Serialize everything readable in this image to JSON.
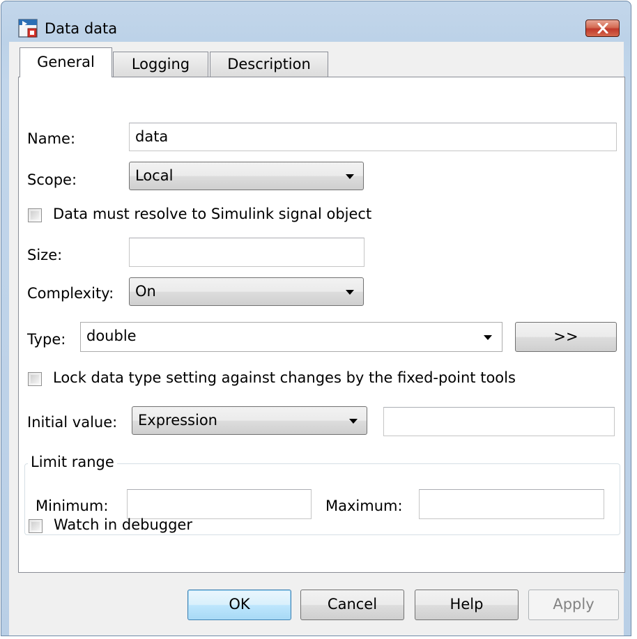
{
  "window": {
    "title": "Data data",
    "icon": "simulink-data-icon",
    "close_icon": "close-icon",
    "close_button_color": "#c9432f"
  },
  "tabs": [
    {
      "label": "General",
      "active": true
    },
    {
      "label": "Logging",
      "active": false
    },
    {
      "label": "Description",
      "active": false
    }
  ],
  "general": {
    "name_label": "Name:",
    "name_value": "data",
    "scope_label": "Scope:",
    "scope_value": "Local",
    "resolve_checkbox_label": "Data must resolve to Simulink signal object",
    "resolve_checked": false,
    "size_label": "Size:",
    "size_value": "",
    "complexity_label": "Complexity:",
    "complexity_value": "On",
    "type_label": "Type:",
    "type_value": "double",
    "type_assistant_label": ">>",
    "lock_checkbox_label": "Lock data type setting against changes by the fixed-point tools",
    "lock_checked": false,
    "initial_value_label": "Initial value:",
    "initial_value_mode": "Expression",
    "initial_value_text": "",
    "limit_range": {
      "legend": "Limit range",
      "minimum_label": "Minimum:",
      "minimum_value": "",
      "maximum_label": "Maximum:",
      "maximum_value": ""
    },
    "watch_checkbox_label": "Watch in debugger",
    "watch_checked": false
  },
  "buttons": {
    "ok": "OK",
    "cancel": "Cancel",
    "help": "Help",
    "apply": "Apply",
    "apply_enabled": false
  }
}
